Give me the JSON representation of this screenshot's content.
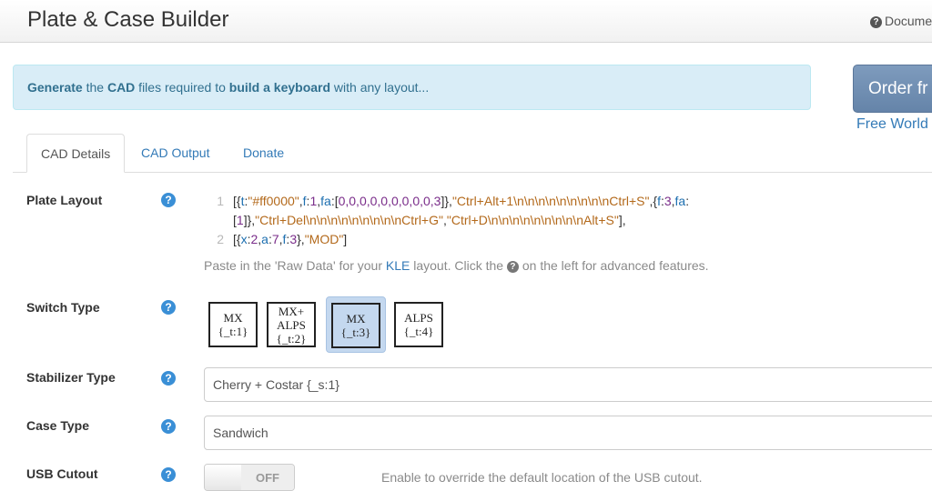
{
  "header": {
    "title": "Plate & Case Builder",
    "docs_label": "Docume"
  },
  "alert": {
    "part1": "Generate",
    "part2": " the ",
    "part3": "CAD",
    "part4": " files required to ",
    "part5": "build a keyboard",
    "part6": " with any layout..."
  },
  "order": {
    "button_label": "Order fr",
    "shipping_text": "Free World"
  },
  "tabs": [
    {
      "label": "CAD Details",
      "active": true
    },
    {
      "label": "CAD Output",
      "active": false
    },
    {
      "label": "Donate",
      "active": false
    }
  ],
  "plate_layout": {
    "label": "Plate Layout",
    "help_glyph": "?",
    "line_numbers": [
      "1",
      "2"
    ],
    "code": {
      "l1a": "[{",
      "l1b": "t",
      "l1c": ":",
      "l1d": "\"#ff0000\"",
      "l1e": ",",
      "l1f": "f",
      "l1g": ":",
      "l1h": "1",
      "l1i": ",",
      "l1j": "fa",
      "l1k": ":[",
      "l1l": "0,0,0,0,0,0,0,0,0,3",
      "l1m": "]},",
      "l1n": "\"Ctrl+Alt+1\\n\\n\\n\\n\\n\\n\\n\\n\\nCtrl+S\"",
      "l1o": ",{",
      "l1p": "f",
      "l1q": ":",
      "l1r": "3",
      "l1s": ",",
      "l1t": "fa",
      "l1u": ":",
      "l1v": "[",
      "l1w": "1",
      "l1x": "]},",
      "l1y": "\"Ctrl+Del\\n\\n\\n\\n\\n\\n\\n\\n\\nCtrl+G\"",
      "l1z": ",",
      "l1aa": "\"Ctrl+D\\n\\n\\n\\n\\n\\n\\n\\n\\nAlt+S\"",
      "l1ab": "],",
      "l2a": "[{",
      "l2b": "x",
      "l2c": ":",
      "l2d": "2",
      "l2e": ",",
      "l2f": "a",
      "l2g": ":",
      "l2h": "7",
      "l2i": ",",
      "l2j": "f",
      "l2k": ":",
      "l2l": "3",
      "l2m": "},",
      "l2n": "\"MOD\"",
      "l2o": "]"
    },
    "hint_pre": "Paste in the 'Raw Data' for your ",
    "hint_link": "KLE",
    "hint_mid": " layout. Click the ",
    "hint_post": " on the left for advanced features."
  },
  "switch_type": {
    "label": "Switch Type",
    "help_glyph": "?",
    "selected_index": 2,
    "options": [
      {
        "line1": "MX",
        "line2": "",
        "line3": "{_t:1}"
      },
      {
        "line1": "MX+",
        "line2": "ALPS",
        "line3": "{_t:2}"
      },
      {
        "line1": "MX",
        "line2": "",
        "line3": "{_t:3}"
      },
      {
        "line1": "ALPS",
        "line2": "",
        "line3": "{_t:4}"
      }
    ]
  },
  "stabilizer_type": {
    "label": "Stabilizer Type",
    "help_glyph": "?",
    "value": "Cherry + Costar {_s:1}"
  },
  "case_type": {
    "label": "Case Type",
    "help_glyph": "?",
    "value": "Sandwich"
  },
  "usb_cutout": {
    "label": "USB Cutout",
    "help_glyph": "?",
    "toggle_label": "OFF",
    "hint": "Enable to override the default location of the USB cutout."
  },
  "colors": {
    "accent": "#337ab7",
    "help_icon": "#3a8fd6",
    "alert_bg": "#d9edf7",
    "alert_text": "#31708f",
    "selected_switch": "#c4d8ef"
  }
}
